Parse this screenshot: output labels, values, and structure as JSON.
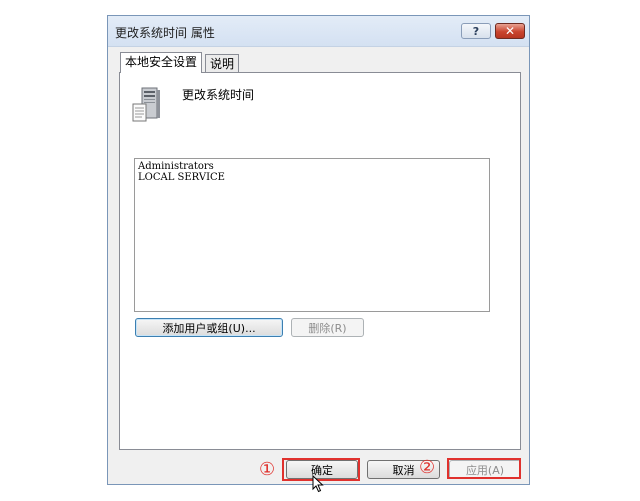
{
  "dialog": {
    "title": "更改系统时间 属性",
    "help_glyph": "?",
    "close_glyph": "✕"
  },
  "tabs": [
    {
      "label": "本地安全设置"
    },
    {
      "label": "说明"
    }
  ],
  "policy": {
    "icon": "server-computer-icon",
    "name": "更改系统时间"
  },
  "members": [
    "Administrators",
    "LOCAL SERVICE"
  ],
  "buttons": {
    "add": "添加用户或组(U)...",
    "remove": "删除(R)",
    "ok": "确定",
    "cancel": "取消",
    "apply": "应用(A)"
  },
  "annotations": {
    "marker1": "①",
    "marker2": "②",
    "color": "#e0312d"
  }
}
